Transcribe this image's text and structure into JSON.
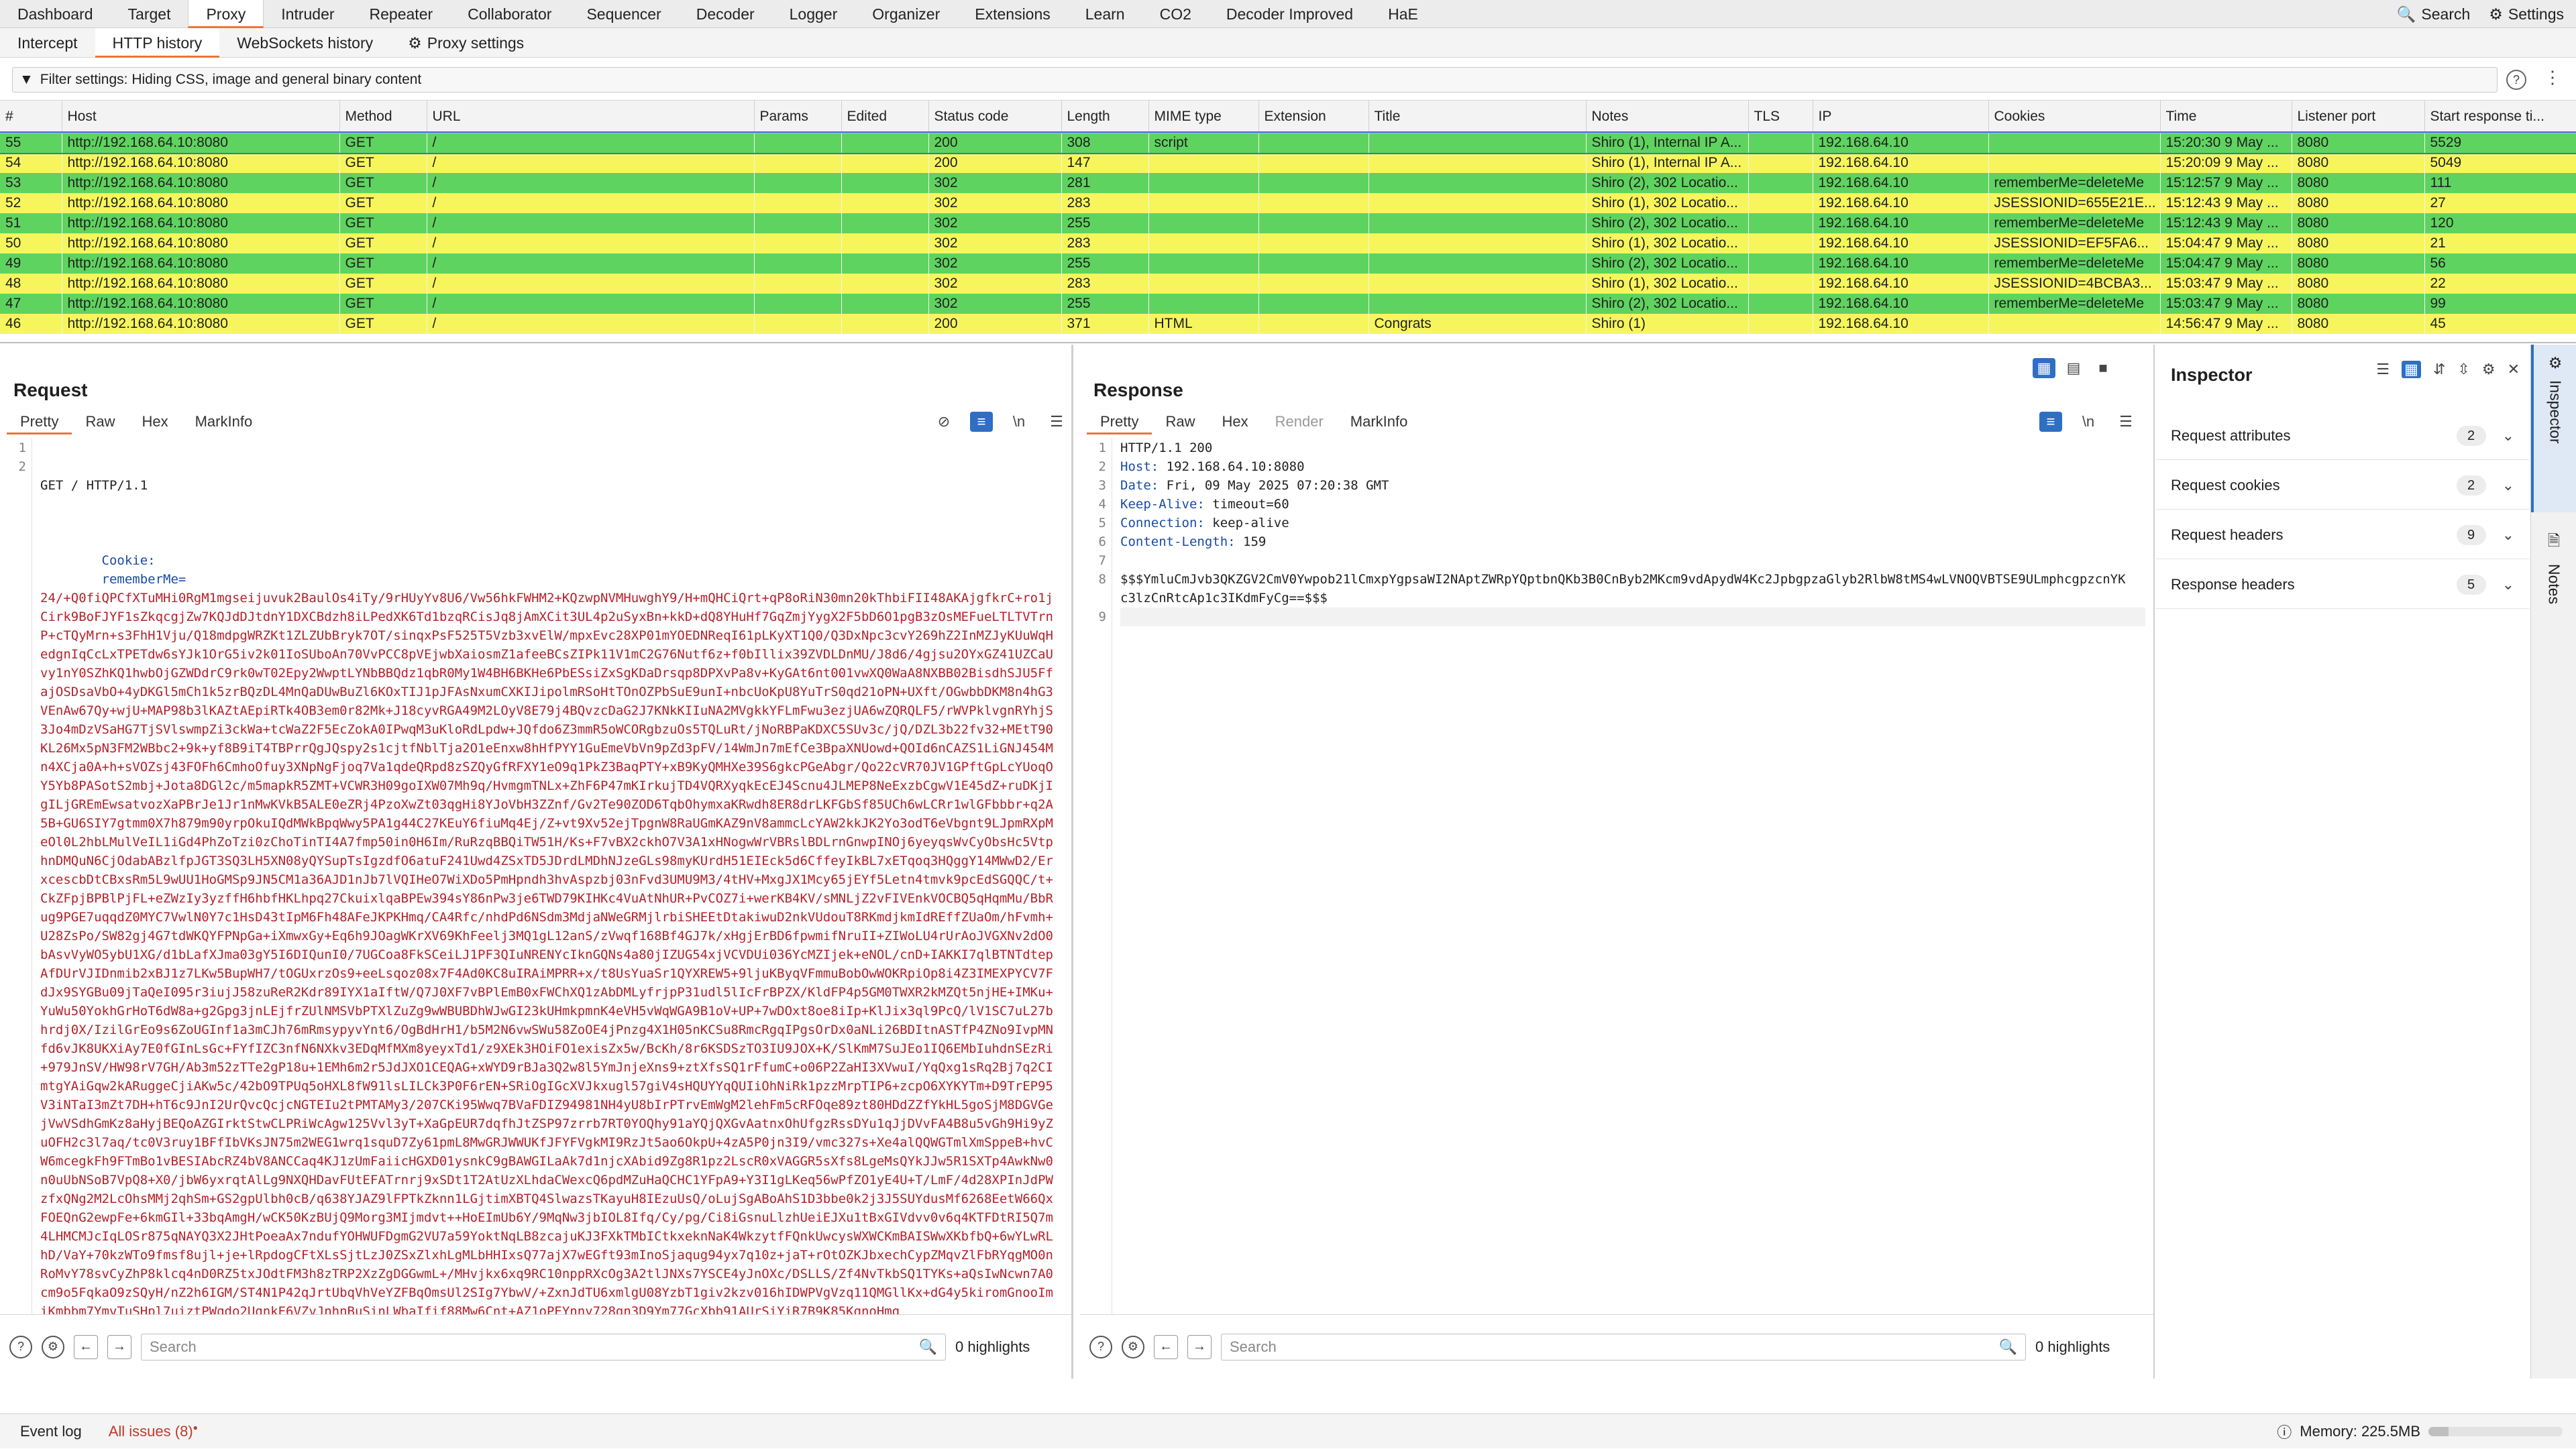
{
  "topnav": {
    "items": [
      "Dashboard",
      "Target",
      "Proxy",
      "Intruder",
      "Repeater",
      "Collaborator",
      "Sequencer",
      "Decoder",
      "Logger",
      "Organizer",
      "Extensions",
      "Learn",
      "CO2",
      "Decoder Improved",
      "HaE"
    ],
    "active": "Proxy",
    "search_label": "Search",
    "settings_label": "Settings"
  },
  "subnav": {
    "items": [
      "Intercept",
      "HTTP history",
      "WebSockets history"
    ],
    "proxy_settings_label": "Proxy settings"
  },
  "filter": {
    "text": "Filter settings: Hiding CSS, image and general binary content"
  },
  "history": {
    "columns": [
      "#",
      "Host",
      "Method",
      "URL",
      "Params",
      "Edited",
      "Status code",
      "Length",
      "MIME type",
      "Extension",
      "Title",
      "Notes",
      "TLS",
      "IP",
      "Cookies",
      "Time",
      "Listener port",
      "Start response ti..."
    ],
    "rows": [
      {
        "num": "55",
        "host": "http://192.168.64.10:8080",
        "method": "GET",
        "url": "/",
        "params": "",
        "edited": "",
        "status": "200",
        "length": "308",
        "mime": "script",
        "ext": "",
        "title": "",
        "notes": "Shiro (1), Internal IP A...",
        "tls": "",
        "ip": "192.168.64.10",
        "cookies": "",
        "time": "15:20:30 9 May ...",
        "port": "8080",
        "start": "5529",
        "color": "#5fd35f",
        "selected": true
      },
      {
        "num": "54",
        "host": "http://192.168.64.10:8080",
        "method": "GET",
        "url": "/",
        "params": "",
        "edited": "",
        "status": "200",
        "length": "147",
        "mime": "",
        "ext": "",
        "title": "",
        "notes": "Shiro (1), Internal IP A...",
        "tls": "",
        "ip": "192.168.64.10",
        "cookies": "",
        "time": "15:20:09 9 May ...",
        "port": "8080",
        "start": "5049",
        "color": "#f6f65c"
      },
      {
        "num": "53",
        "host": "http://192.168.64.10:8080",
        "method": "GET",
        "url": "/",
        "params": "",
        "edited": "",
        "status": "302",
        "length": "281",
        "mime": "",
        "ext": "",
        "title": "",
        "notes": "Shiro (2), 302 Locatio...",
        "tls": "",
        "ip": "192.168.64.10",
        "cookies": "rememberMe=deleteMe",
        "time": "15:12:57 9 May ...",
        "port": "8080",
        "start": "111",
        "color": "#5fd35f"
      },
      {
        "num": "52",
        "host": "http://192.168.64.10:8080",
        "method": "GET",
        "url": "/",
        "params": "",
        "edited": "",
        "status": "302",
        "length": "283",
        "mime": "",
        "ext": "",
        "title": "",
        "notes": "Shiro (1), 302 Locatio...",
        "tls": "",
        "ip": "192.168.64.10",
        "cookies": "JSESSIONID=655E21E...",
        "time": "15:12:43 9 May ...",
        "port": "8080",
        "start": "27",
        "color": "#f6f65c"
      },
      {
        "num": "51",
        "host": "http://192.168.64.10:8080",
        "method": "GET",
        "url": "/",
        "params": "",
        "edited": "",
        "status": "302",
        "length": "255",
        "mime": "",
        "ext": "",
        "title": "",
        "notes": "Shiro (2), 302 Locatio...",
        "tls": "",
        "ip": "192.168.64.10",
        "cookies": "rememberMe=deleteMe",
        "time": "15:12:43 9 May ...",
        "port": "8080",
        "start": "120",
        "color": "#5fd35f"
      },
      {
        "num": "50",
        "host": "http://192.168.64.10:8080",
        "method": "GET",
        "url": "/",
        "params": "",
        "edited": "",
        "status": "302",
        "length": "283",
        "mime": "",
        "ext": "",
        "title": "",
        "notes": "Shiro (1), 302 Locatio...",
        "tls": "",
        "ip": "192.168.64.10",
        "cookies": "JSESSIONID=EF5FA6...",
        "time": "15:04:47 9 May ...",
        "port": "8080",
        "start": "21",
        "color": "#f6f65c"
      },
      {
        "num": "49",
        "host": "http://192.168.64.10:8080",
        "method": "GET",
        "url": "/",
        "params": "",
        "edited": "",
        "status": "302",
        "length": "255",
        "mime": "",
        "ext": "",
        "title": "",
        "notes": "Shiro (2), 302 Locatio...",
        "tls": "",
        "ip": "192.168.64.10",
        "cookies": "rememberMe=deleteMe",
        "time": "15:04:47 9 May ...",
        "port": "8080",
        "start": "56",
        "color": "#5fd35f"
      },
      {
        "num": "48",
        "host": "http://192.168.64.10:8080",
        "method": "GET",
        "url": "/",
        "params": "",
        "edited": "",
        "status": "302",
        "length": "283",
        "mime": "",
        "ext": "",
        "title": "",
        "notes": "Shiro (1), 302 Locatio...",
        "tls": "",
        "ip": "192.168.64.10",
        "cookies": "JSESSIONID=4BCBA3...",
        "time": "15:03:47 9 May ...",
        "port": "8080",
        "start": "22",
        "color": "#f6f65c"
      },
      {
        "num": "47",
        "host": "http://192.168.64.10:8080",
        "method": "GET",
        "url": "/",
        "params": "",
        "edited": "",
        "status": "302",
        "length": "255",
        "mime": "",
        "ext": "",
        "title": "",
        "notes": "Shiro (2), 302 Locatio...",
        "tls": "",
        "ip": "192.168.64.10",
        "cookies": "rememberMe=deleteMe",
        "time": "15:03:47 9 May ...",
        "port": "8080",
        "start": "99",
        "color": "#5fd35f"
      },
      {
        "num": "46",
        "host": "http://192.168.64.10:8080",
        "method": "GET",
        "url": "/",
        "params": "",
        "edited": "",
        "status": "200",
        "length": "371",
        "mime": "HTML",
        "ext": "",
        "title": "Congrats",
        "notes": "Shiro (1)",
        "tls": "",
        "ip": "192.168.64.10",
        "cookies": "",
        "time": "14:56:47 9 May ...",
        "port": "8080",
        "start": "45",
        "color": "#f6f65c"
      }
    ]
  },
  "request": {
    "title": "Request",
    "tabs": [
      "Pretty",
      "Raw",
      "Hex",
      "MarkInfo"
    ],
    "line1": "GET / HTTP/1.1",
    "cookie_key": "Cookie:",
    "cookie_name": "rememberMe=",
    "cookie_value": "24/+Q0fiQPCfXTuMHi0RgM1mgseijuvuk2BaulOs4iTy/9rHUyYv8U6/Vw56hkFWHM2+KQzwpNVMHuwghY9/H+mQHCiQrt+qP8oRiN30mn20kThbiFII48AKAjgfkrC+ro1jCirk9BoFJYF1sZkqcgjZw7KQJdDJtdnY1DXCBdzh8iLPedXK6Td1bzqRCisJq8jAmXCit3UL4p2uSyxBn+kkD+dQ8YHuHf7GqZmjYygX2F5bD6O1pgB3zOsMEFueLTLTVTrnP+cTQyMrn+s3FhH1Vju/Q18mdpgWRZKt1ZLZUbBryk7OT/sinqxPsF525T5Vzb3xvElW/mpxEvc28XP01mYOEDNReqI61pLKyXT1Q0/Q3DxNpc3cvY269hZ2InMZJyKUuWqHedgnIqCcLxTPETdw6sYJk1OrG5iv2k01IoSUboAn70VvPCC8pVEjwbXaiosmZ1afeeBCsZIPk11V1mC2G76Nutf6z+f0bIllix39ZVDLDnMU/J8d6/4gjsu2OYxGZ41UZCaUvy1nY0SZhKQ1hwbOjGZWDdrC9rk0wT02Epy2WwptLYNbBBQdz1qbR0My1W4BH6BKHe6PbESsiZxSgKDaDrsqp8DPXvPa8v+KyGAt6nt001vwXQ0WaA8NXBB02BisdhSJU5FfajOSDsaVbO+4yDKGl5mCh1k5zrBQzDL4MnQaDUwBuZl6KOxTIJ1pJFAsNxumCXKIJipolmRSoHtTOnOZPbSuE9unI+nbcUoKpU8YuTrS0qd21oPN+UXft/OGwbbDKM8n4hG3VEnAw67Qy+wjU+MAP98b3lKAZtAEpiRTk4OB3em0r82Mk+J18cyvRGA49M2LOyV8E79j4BQvzcDaG2J7KNkKIIuNA2MVgkkYFLmFwu3ezjUA6wZQRQLF5/rWVPklvgnRYhjS3Jo4mDzVSaHG7TjSVlswmpZi3ckWa+tcWaZ2F5EcZokA0IPwqM3uKloRdLpdw+JQfdo6Z3mmR5oWCORgbzuOs5TQLuRt/jNoRBPaKDXC5SUv3c/jQ/DZL3b22fv32+MEtT90KL26Mx5pN3FM2WBbc2+9k+yf8B9iT4TBPrrQgJQspy2s1cjtfNblTja2O1eEnxw8hHfPYY1GuEmeVbVn9pZd3pFV/14WmJn7mEfCe3BpaXNUowd+QOId6nCAZS1LiGNJ454Mn4XCja0A+h+sVOZsj43FOFh6CmhoOfuy3XNpNgFjoq7Va1qdeQRpd8zSZQyGfRFXY1eO9q1PkZ3BaqPTY+xB9KyQMHXe39S6gkcPGeAbgr/Qo22cVR70JV1GPftGpLcYUoqOY5Yb8PASotS2mbj+Jota8DGl2c/m5mapkR5ZMT+VCWR3H09goIXW07Mh9q/HvmgmTNLx+ZhF6P47mKIrkujTD4VQRXyqkEcEJ4Scnu4JLMEP8NeExzbCgwV1E45dZ+ruDKjIgILjGREmEwsatvozXaPBrJe1Jr1nMwKVkB5ALE0eZRj4PzoXwZt03qgHi8YJoVbH3ZZnf/Gv2Te90ZOD6TqbOhymxaKRwdh8ER8drLKFGbSf85UCh6wLCRr1wlGFbbbr+q2A5B+GU6SIY7gtmm0X7h879m90yrpOkuIQdMWkBpqWwy5PA1g44C27KEuY6fiuMq4Ej/Z+vt9Xv52ejTpgnW8RaUGmKAZ9nV8ammcLcYAW2kkJK2Yo3odT6eVbgnt9LJpmRXpMeOl0L2hbLMulVeIL1iGd4PhZoTzi0zChoTinTI4A7fmp50in0H6Im/RuRzqBBQiTW51H/Ks+F7vBX2ckhO7V3A1xHNogwWrVBRslBDLrnGnwpINOj6yeyqsWvCyObsHc5VtphnDMQuN6CjOdabABzlfpJGT3SQ3LH5XN08yQYSupTsIgzdfO6atuF241Uwd4ZSxTD5JDrdLMDhNJzeGLs98myKUrdH51EIEck5d6CffeyIkBL7xETqoq3HQggY14MWwD2/ErxcescbDtCBxsRm5L9wUU1HoGMSp9JN5CM1a36AJD1nJb7lVQIHeO7WiXDo5PmHpndh3hvAspzbj03nFvd3UMU9M3/4tHV+MxgJX1Mcy65jEYf5Letn4tmvk9pcEdSGQQC/t+CkZFpjBPBlPjFL+eZWzIy3yzffH6hbfHKLhpq27CkuixlqaBPEw394sY86nPw3je6TWD79KIHKc4VuAtNhUR+PvCOZ7i+werKB4KV/sMNLjZ2vFIVEnkVOCBQ5qHqmMu/BbRug9PGE7uqqdZ0MYC7VwlN0Y7c1HsD43tIpM6Fh48AFeJKPKHmq/CA4Rfc/nhdPd6NSdm3MdjaNWeGRMjlrbiSHEEtDtakiwuD2nkVUdouT8RKmdjkmIdREffZUaOm/hFvmh+U28ZsPo/SW82gj4G7tdWKQYFPNpGa+iXmwxGy+Eq6h9JOagWKrXV69KhFeelj3MQ1gL12anS/zVwqf168Bf4GJ7k/xHgjErBD6fpwmifNruII+ZIWoLU4rUrAoJVGXNv2dO0bAsvVyWO5ybU1XG/d1bLafXJma03gY5I6DIQunI0/7UGCoa8FkSCeiLJ1PF3QIuNRENYcIknGQNs4a80jIZUG54xjVCVDUi036YcMZIjek+eNOL/cnD+IAKKI7qlBTNTdtepAfDUrVJIDnmib2xBJ1z7LKw5BupWH7/tOGUxrzOs9+eeLsqoz08x7F4Ad0KC8uIRAiMPRR+x/t8UsYuaSr1QYXREW5+9ljuKByqVFmmuBobOwWOKRpiOp8i4Z3IMEXPYCV7FdJx9SYGBu09jTaQeI095r3iujJ58zuReR2Kdr89IYX1aIftW/Q7J0XF7vBPlEmB0xFWChXQ1zAbDMLyfrjpP31udl5lIcFrBPZX/KldFP4p5GM0TWXR2kMZQt5njHE+IMKu+YuWu50YokhGrHoT6dW8a+g2Gpg3jnLEjfrZUlNMSVbPTXlZuZg9wWBUBDhWJwGI23kUHmkpmnK4eVH5vWqWGA9B1oV+UP+7wDOxt8oe8iIp+KlJix3ql9PcQ/lV1SC7uL27bhrdj0X/IzilGrEo9s6ZoUGInf1a3mCJh76mRmsypyvYnt6/OgBdHrH1/b5M2N6vwSWu58ZoOE4jPnzg4X1H05nKCSu8RmcRgqIPgsOrDx0aNLi26BDItnASTfP4ZNo9IvpMNfd6vJK8UKXiAy7E0fGInLsGc+FYfIZC3nfN6NXkv3EDqMfMXm8yeyxTd1/z9XEk3HOiFO1exisZx5w/BcKh/8r6KSDSzTO3IU9JOX+K/SlKmM7SuJEo1IQ6EMbIuhdnSEzRi+979JnSV/HW98rV7GH/Ab3m52zTTe2gP18u+1EMh6m2r5JdJXO1CEQAG+xWYD9rBJa3Q2w8l5YmJnjeXns9+ztXfsSQ1rFfumC+o06P2ZaHI3XVwuI/YqQxg1sRq2Bj7q2CImtgYAiGqw2kARuggeCjiAKw5c/42bO9TPUq5oHXL8fW91lsLILCk3P0F6rEN+SRiOgIGcXVJkxugl57giV4sHQUYYqQUIiOhNiRk1pzzMrpTIP6+zcpO6XYKYTm+D9TrEP95V3iNTaI3mZt7DH+hT6c9JnI2UrQvcQcjcNGTEIu2tPMTAMy3/207CKi95Wwq7BVaFDIZ94981NH4yU8bIrPTrvEmWgM2lehFm5cRFOqe89zt80HDdZZfYkHL5goSjM8DGVGejVwVSdhGmKz8aHyjBEQoAZGIrktStwCLPRiWcAgw125Vvl3yT+XaGpEUR7dqfhJtZSP97zrrb7RT0YOQhy91aYQjQXGvAatnxOhUfgzRssDYu1qJjDVvFA4B8u5vGh9Hi9yZuOFH2c3l7aq/tc0V3ruy1BFfIbVKsJN75m2WEG1wrq1squD7Zy61pmL8MwGRJWWUKfJFYFVgkMI9RzJt5ao6OkpU+4zA5P0jn3I9/vmc327s+Xe4alQQWGTmlXmSppeB+hvCW6mcegkFh9FTmBo1vBESIAbcRZ4bV8ANCCaq4KJ1zUmFaiicHGXD01ysnkC9gBAWGILaAk7d1njcXAbid9Zg8R1pz2LscR0xVAGGR5sXfs8LgeMsQYkJJw5R1SXTp4AwkNw0n0uUbNSoB7VpQ8+X0/jbW6yxrqtAlLg9NXQHDavFUtEFATrnrj9xSDt1T2AtUzXLhdaCWexcQ6pdMZuHaQCHC1YFpA9+Y3I1gLKeq56wPfZO1yE4U+T/LmF/4d28XPInJdPWzfxQNg2M2LcOhsMMj2qhSm+GS2gpUlbh0cB/q638YJAZ9lFPTkZknn1LGjtimXBTQ4SlwazsTKayuH8IEzuUsQ/oLujSgABoAhS1D3bbe0k2j3J5SUYdusMf6268EetW66QxFOEQnG2ewpFe+6kmGIl+33bqAmgH/wCK50KzBUjQ9Morg3MIjmdvt++HoEImUb6Y/9MqNw3jbIOL8Ifq/Cy/pg/Ci8iGsnuLlzhUeiEJXu1tBxGIVdvv0v6q4KTFDtRI5Q7m4LHMCMJcIqLOSr875qNAYQ3X2JHtPoeaAx7ndufYOHWUFDgmG2VU7a59YoktNqLB8zcajuKJ3FXkTMbICtkxeknNaK4WkzytfFQnkUwcysWXWCKmBAISWwXKbfbQ+6wYLwRLhD/VaY+70kzWTo9fmsf8ujl+je+lRpdogCFtXLsSjtLzJ0ZSxZlxhLgMLbHHIxsQ77ajX7wEGft93mInoSjaqug94yx7q10z+jaT+rOtOZKJbxechCypZMqvZlFbRYqgMO0nRoMvY78svCyZhP8klcq4nD0RZ5txJOdtFM3h8zTRP2XzZgDGGwmL+/MHvjkx6xq9RC10nppRXcOg3A2tlJNXs7YSCE4yJnOXc/DSLLS/Zf4NvTkbSQ1TYKs+aQsIwNcwn7A0cm9o5FqkaO9zSQyH/nZ2h6IGM/ST4N1P42qJrtUbqVhVeYZFBqOmsUl2SIg7YbwV/+ZxnJdTU6xmlgU08YzbT1giv2kzv016hIDWPVgVzq11QMGllKx+dG4y5kiromGnooImiKmbbm7YmvTuSHpl7uiztPWqdo2UqnkE6VZvJnhnBuSinLWbaIfif88Mw6Cnt+AZ1oPEYnny728gn3D9Ym77GcXbb91AUrSiYiR7B9K85KqnoHmg"
  },
  "response": {
    "title": "Response",
    "tabs": [
      "Pretty",
      "Raw",
      "Hex",
      "Render",
      "MarkInfo"
    ],
    "lines": [
      {
        "key": "",
        "value": "HTTP/1.1 200"
      },
      {
        "key": "Host:",
        "value": "192.168.64.10:8080"
      },
      {
        "key": "Date:",
        "value": "Fri, 09 May 2025 07:20:38 GMT"
      },
      {
        "key": "Keep-Alive:",
        "value": "timeout=60"
      },
      {
        "key": "Connection:",
        "value": "keep-alive"
      },
      {
        "key": "Content-Length:",
        "value": "159"
      },
      {
        "key": "",
        "value": ""
      },
      {
        "key": "",
        "value": "$$$YmluCmJvb3QKZGV2CmV0Ywpob21lCmxpYgpsaWI2NAptZWRpYQptbnQKb3B0CnByb2MKcm9vdApydW4Kc2JpbgpzaGlyb2RlbW8tMS4wLVNOQVBTSE9ULmphcgpzcnYKc3lzCnRtcAp1c3IKdmFyCg==$$$"
      },
      {
        "key": "",
        "value": ""
      }
    ]
  },
  "footer": {
    "search_placeholder": "Search",
    "highlights": "0 highlights"
  },
  "inspector": {
    "title": "Inspector",
    "rows": [
      {
        "label": "Request attributes",
        "count": "2"
      },
      {
        "label": "Request cookies",
        "count": "2"
      },
      {
        "label": "Request headers",
        "count": "9"
      },
      {
        "label": "Response headers",
        "count": "5"
      }
    ]
  },
  "sidebar": {
    "inspector_label": "Inspector",
    "notes_label": "Notes"
  },
  "status": {
    "event_log": "Event log",
    "all_issues": "All issues (8)",
    "memory": "Memory: 225.5MB",
    "memory_fraction": 0.15
  }
}
